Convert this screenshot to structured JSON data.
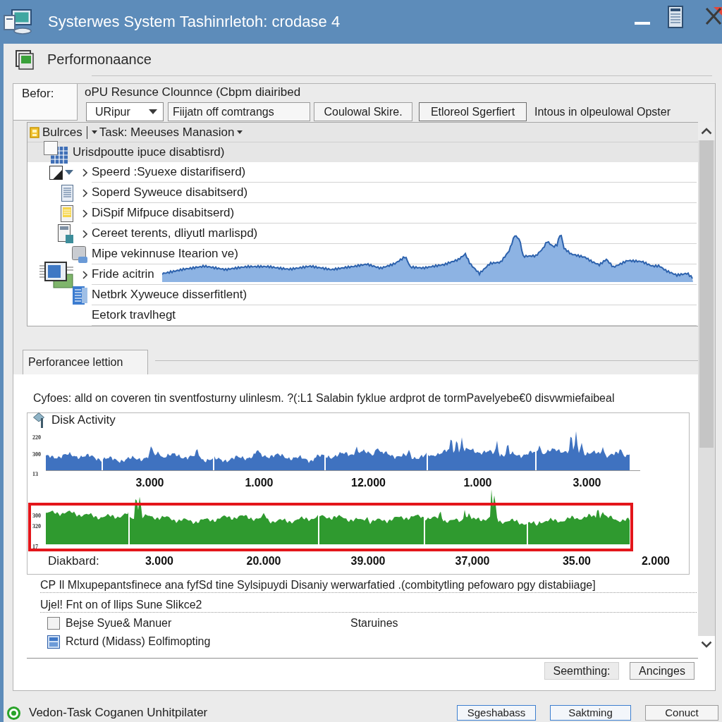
{
  "window": {
    "title": "Systerwes System Tashinrletoh: crodase 4"
  },
  "header": {
    "title": "Performonaance"
  },
  "filter": {
    "tab": "Befor:",
    "caption": "oPU Resunce Clounnce (Cbpm diairibed",
    "dropdown": {
      "value": "URipur"
    },
    "field": {
      "value": "Fiijatn off comtrangs"
    },
    "buttons": [
      "Coulowal Skire.",
      "Etloreol Sgerfiert"
    ],
    "note": "Intous in olpeulowal Opster"
  },
  "tree": {
    "header": {
      "label": "Bulrces",
      "menu": "Task: Meeuses Manasion"
    },
    "items": [
      {
        "label": "Urisdpoutte ipuce disabtisrd)",
        "kind": "grid",
        "selected": true,
        "children": [
          {
            "label": "Speerd :Syuexe distarifiserd)",
            "kind": "window",
            "selected": false,
            "expanded": false
          },
          {
            "label": "Soperd Syweuce disabitserd)",
            "kind": "document",
            "selected": false,
            "expanded": false
          },
          {
            "label": "DiSpif Mifpuce disabitserd)",
            "kind": "note",
            "selected": false,
            "expanded": false
          },
          {
            "label": "Cereet terents, dliyutl marlispd)",
            "kind": "form",
            "selected": false,
            "expanded": false
          },
          {
            "label": "Mipe vekinnuse Itearion ve)",
            "kind": "tile",
            "selected": false
          },
          {
            "label": "Fride acitrin",
            "kind": "monitor",
            "selected": false,
            "expanded": false
          },
          {
            "label": "Netbrk Xyweuce disserfitlent)",
            "kind": "sheet",
            "selected": false
          },
          {
            "label": "Eetork travlhegt",
            "kind": "plain",
            "selected": false
          }
        ]
      }
    ]
  },
  "performance": {
    "tab": "Perforancee lettion",
    "description": "Cyfoes: alld on coveren tin sventfosturny ulinlesm. ?(:L1 Salabin fyklue ardprot de tormPavelyebe€0 disvwmiefaibeal",
    "chart": {
      "title": "Disk Activity",
      "upper_scale": [
        "220",
        "300",
        "13"
      ],
      "upper_values": [
        "3.000",
        "1.000",
        "12.000",
        "1.000",
        "3.000"
      ],
      "lower_scale": [
        "300",
        "320",
        "17"
      ],
      "lower_caption": "Diakbard:",
      "lower_values": [
        "3.000",
        "20.000",
        "39.000",
        "37,000",
        "35.00",
        "2.000"
      ],
      "highlighted": true
    },
    "summary": "CP Il Mlxupepantsfinece ana fyfSd tine Sylsipuydi Disaniy werwarfatied .(combitytling pefowaro pgy distabiiage]",
    "subtitle": "Ujel! Fnt on of llips Sune Slikce2",
    "options": [
      {
        "kind": "checkbox",
        "label": "Bejse Syue& Manuer",
        "value": "Staruines",
        "checked": false
      },
      {
        "kind": "window",
        "label": "Rcturd (Midass) Eolfimopting"
      }
    ],
    "buttons": [
      "Seemthing:",
      "Ancinges"
    ]
  },
  "status_bar": {
    "text": "Vedon-Task Coganen Unhitpilater",
    "buttons": [
      "Sgeshabass",
      "Saktming",
      "Conuct"
    ]
  }
}
